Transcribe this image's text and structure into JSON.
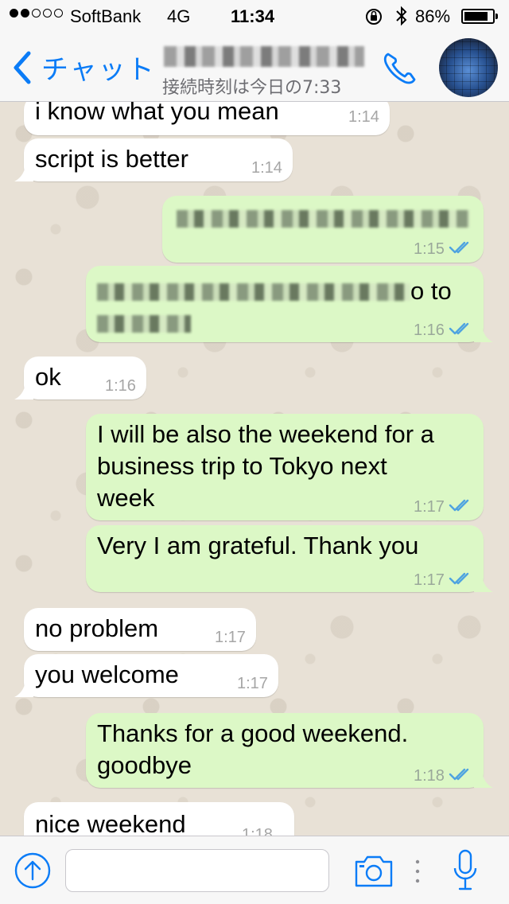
{
  "status": {
    "carrier": "SoftBank",
    "network": "4G",
    "time": "11:34",
    "battery": "86%",
    "battery_level": 0.86,
    "signal_strength": 2
  },
  "nav": {
    "back_label": "チャット",
    "contact_name": "",
    "subtitle": "接続時刻は今日の7:33",
    "accent": "#0b7cf7"
  },
  "messages": [
    {
      "dir": "in",
      "text": "i know what you mean",
      "time": "1:14"
    },
    {
      "dir": "in",
      "text": "script is better",
      "time": "1:14"
    },
    {
      "dir": "out",
      "text": "",
      "time": "1:15",
      "redacted": true
    },
    {
      "dir": "out",
      "text": "o to",
      "time": "1:16",
      "redacted": true
    },
    {
      "dir": "in",
      "text": "ok",
      "time": "1:16"
    },
    {
      "dir": "out",
      "text": "I will be also the weekend for a\nbusiness trip to Tokyo next\nweek",
      "time": "1:17"
    },
    {
      "dir": "out",
      "text": "Very I am grateful. Thank you",
      "time": "1:17"
    },
    {
      "dir": "in",
      "text": "no problem",
      "time": "1:17"
    },
    {
      "dir": "in",
      "text": "you welcome",
      "time": "1:17"
    },
    {
      "dir": "out",
      "text": "Thanks for a good weekend.\ngoodbye",
      "time": "1:18"
    },
    {
      "dir": "in",
      "text": "nice weekend",
      "time": "1:18"
    }
  ],
  "input": {
    "placeholder": "",
    "value": ""
  },
  "colors": {
    "incoming": "#ffffff",
    "outgoing": "#dcf8c6",
    "read_ticks": "#4fa3e0",
    "background": "#e5ddd5"
  }
}
